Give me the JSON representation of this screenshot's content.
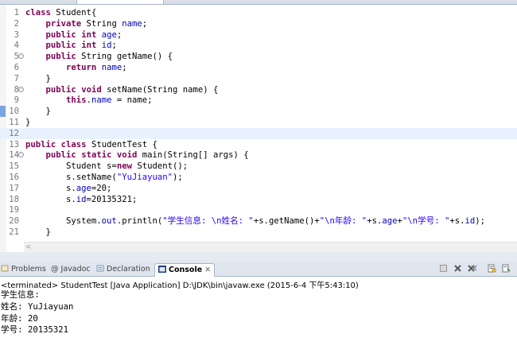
{
  "editor": {
    "lines": [
      {
        "n": "1",
        "fold": "",
        "html": "<span class='kw'>class</span> Student{"
      },
      {
        "n": "2",
        "fold": "",
        "html": "    <span class='kw'>private</span> String <span class='fld'>name</span>;"
      },
      {
        "n": "3",
        "fold": "",
        "html": "    <span class='kw'>public</span> <span class='kw'>int</span> <span class='fld'>age</span>;"
      },
      {
        "n": "4",
        "fold": "",
        "html": "    <span class='kw'>public</span> <span class='kw'>int</span> <span class='fld'>id</span>;"
      },
      {
        "n": "5",
        "fold": "-",
        "html": "    <span class='kw'>public</span> String getName() {"
      },
      {
        "n": "6",
        "fold": "",
        "html": "        <span class='kw'>return</span> <span class='fld'>name</span>;"
      },
      {
        "n": "7",
        "fold": "",
        "html": "    }"
      },
      {
        "n": "8",
        "fold": "-",
        "html": "    <span class='kw'>public</span> <span class='kw'>void</span> setName(String name) {"
      },
      {
        "n": "9",
        "fold": "",
        "html": "        <span class='kw'>this</span>.<span class='fld'>name</span> = name;"
      },
      {
        "n": "10",
        "fold": "",
        "html": "    }"
      },
      {
        "n": "11",
        "fold": "",
        "html": "}"
      },
      {
        "n": "12",
        "fold": "",
        "html": ""
      },
      {
        "n": "13",
        "fold": "",
        "html": "<span class='kw'>public</span> <span class='kw'>class</span> StudentTest {"
      },
      {
        "n": "14",
        "fold": "-",
        "html": "    <span class='kw'>public</span> <span class='kw'>static</span> <span class='kw'>void</span> main(String[] args) {"
      },
      {
        "n": "15",
        "fold": "",
        "html": "        Student s=<span class='kw'>new</span> Student();"
      },
      {
        "n": "16",
        "fold": "",
        "html": "        s.setName(<span class='str'>\"YuJiayuan\"</span>);"
      },
      {
        "n": "17",
        "fold": "",
        "html": "        s.<span class='fld'>age</span>=20;"
      },
      {
        "n": "18",
        "fold": "",
        "html": "        s.<span class='fld'>id</span>=20135321;"
      },
      {
        "n": "19",
        "fold": "",
        "html": ""
      },
      {
        "n": "20",
        "fold": "",
        "html": "        System.<span class='fld'>out</span>.println(<span class='str'>\"学生信息: \\n姓名: \"</span>+s.getName()+<span class='str'>\"\\n年龄: \"</span>+s.<span class='fld'>age</span>+<span class='str'>\"\\n学号: \"</span>+s.<span class='fld'>id</span>);"
      },
      {
        "n": "21",
        "fold": "",
        "html": "    }"
      }
    ],
    "scroll_left_arrow": "<"
  },
  "console": {
    "tabs": [
      {
        "label": "Problems",
        "icon": "problems-icon",
        "active": false
      },
      {
        "label": "@ Javadoc",
        "icon": "",
        "active": false
      },
      {
        "label": "Declaration",
        "icon": "declaration-icon",
        "active": false
      },
      {
        "label": "Console",
        "icon": "console-icon",
        "active": true
      }
    ],
    "close_glyph": "✕",
    "toolbar": [
      "terminate-icon",
      "remove-launch-icon",
      "remove-all-icon",
      "scroll-lock-icon",
      "pin-icon"
    ],
    "terminated": "<terminated> StudentTest [Java Application] D:\\JDK\\bin\\javaw.exe (2015-6-4 下午5:43:10)",
    "output": [
      "学生信息:",
      "姓名: YuJiayuan",
      "年龄: 20",
      "学号: 20135321"
    ]
  }
}
